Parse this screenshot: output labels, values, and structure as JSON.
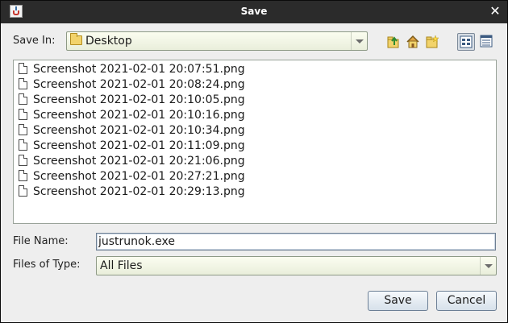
{
  "window": {
    "title": "Save",
    "close_glyph": "✕"
  },
  "save_in": {
    "label": "Save In:",
    "value": "Desktop",
    "folder_icon": "folder-icon"
  },
  "toolbar": {
    "buttons": [
      {
        "name": "up-one-level-icon"
      },
      {
        "name": "home-icon"
      },
      {
        "name": "new-folder-icon"
      },
      {
        "name": "list-view-icon",
        "active": true
      },
      {
        "name": "details-view-icon"
      }
    ]
  },
  "files": [
    "Screenshot 2021-02-01 20:07:51.png",
    "Screenshot 2021-02-01 20:08:24.png",
    "Screenshot 2021-02-01 20:10:05.png",
    "Screenshot 2021-02-01 20:10:16.png",
    "Screenshot 2021-02-01 20:10:34.png",
    "Screenshot 2021-02-01 20:11:09.png",
    "Screenshot 2021-02-01 20:21:06.png",
    "Screenshot 2021-02-01 20:27:21.png",
    "Screenshot 2021-02-01 20:29:13.png"
  ],
  "file_name": {
    "label": "File Name:",
    "value": "justrunok.exe"
  },
  "files_of_type": {
    "label": "Files of Type:",
    "value": "All Files"
  },
  "actions": {
    "save": "Save",
    "cancel": "Cancel"
  },
  "colors": {
    "titlebar": "#2b2b2b",
    "dialog_bg": "#eeeeee",
    "combo_bg": "#f4f7e6",
    "button_bg": "#e3eaf2"
  }
}
